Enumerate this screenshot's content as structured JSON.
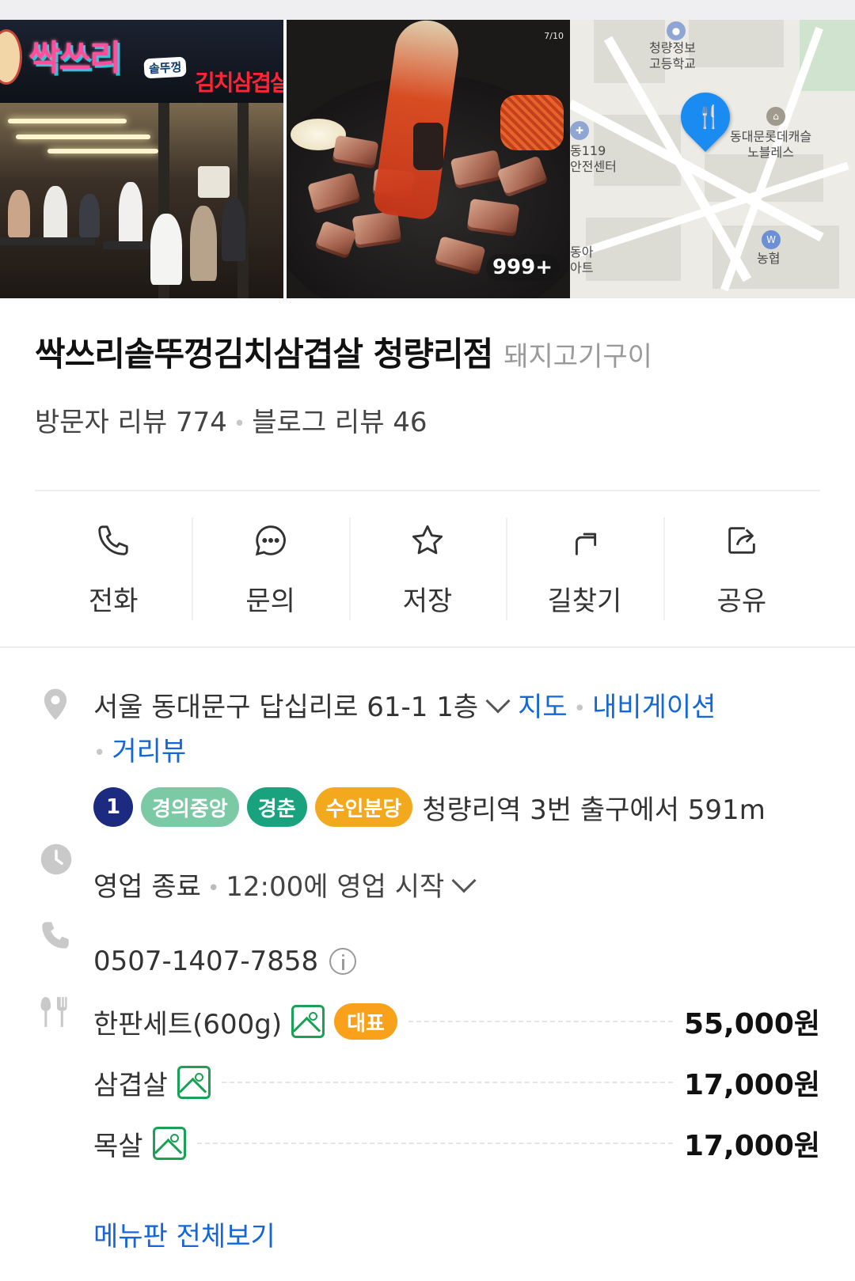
{
  "photos": {
    "storefront": {
      "sign_main": "싹쓰리",
      "sign_sub": "솥뚜껑",
      "sign_red": "김치삼겹살"
    },
    "food": {
      "counter": "7/10",
      "count_badge": "999+"
    },
    "map": {
      "labels": [
        "청량정보\n고등학교",
        "동대문롯데캐슬\n노블레스",
        "동119\n안전센터",
        "농협",
        "동아\n아트"
      ],
      "school": "청량정보",
      "school2": "고등학교",
      "apt": "동대문롯데캐슬",
      "apt2": "노블레스",
      "fire1": "동119",
      "fire2": "안전센터",
      "bank": "농협",
      "apt3": "동아",
      "apt4": "아트"
    }
  },
  "place": {
    "name": "싹쓰리솥뚜껑김치삼겹살 청량리점",
    "category": "돼지고기구이",
    "visitor_reviews": "방문자 리뷰 774",
    "blog_reviews": "블로그 리뷰 46"
  },
  "actions": {
    "call": "전화",
    "inquiry": "문의",
    "save": "저장",
    "directions": "길찾기",
    "share": "공유"
  },
  "info": {
    "address": "서울 동대문구 답십리로 61-1 1층",
    "map_link": "지도",
    "navigation_link": "내비게이션",
    "street_view_link": "거리뷰",
    "subway_lines": {
      "line1": "1",
      "gyeongui": "경의중앙",
      "gyeongchun": "경춘",
      "suinbundang": "수인분당"
    },
    "subway_text": "청량리역 3번 출구에서 591m",
    "hours_status": "영업 종료",
    "hours_next": "12:00에 영업 시작",
    "phone": "0507-1407-7858"
  },
  "menu": {
    "items": [
      {
        "name": "한판세트(600g)",
        "price": "55,000원",
        "badge": "대표"
      },
      {
        "name": "삼겹살",
        "price": "17,000원"
      },
      {
        "name": "목살",
        "price": "17,000원"
      }
    ],
    "view_all": "메뉴판 전체보기"
  },
  "colors": {
    "link": "#1467d8",
    "line1": "#1c2b7f",
    "gyeongui": "#7ccaa5",
    "gyeongchun": "#1aa27e",
    "suinbundang": "#f3a91d",
    "rep_badge": "#f9a11b",
    "photo_icon": "#1aa155",
    "map_pin": "#1a8bf0"
  },
  "icons": [
    "phone-icon",
    "chat-bubble-icon",
    "star-icon",
    "directions-arrow-icon",
    "share-icon",
    "location-pin-icon",
    "clock-icon",
    "phone-small-icon",
    "info-icon",
    "fork-knife-icon",
    "photo-icon",
    "chevron-down-icon"
  ]
}
